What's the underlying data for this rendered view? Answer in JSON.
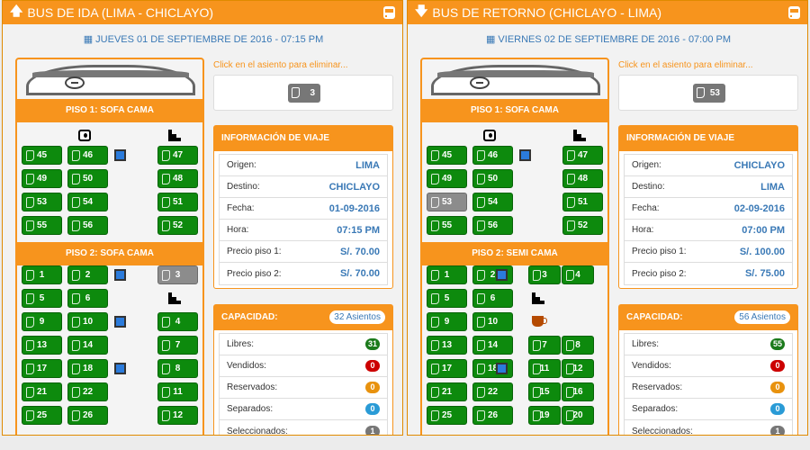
{
  "hint": "Click en el asiento para eliminar...",
  "info_title": "INFORMACIÓN DE VIAJE",
  "cap_title": "CAPACIDAD:",
  "labels": {
    "origen": "Origen:",
    "destino": "Destino:",
    "fecha": "Fecha:",
    "hora": "Hora:",
    "p1": "Precio piso 1:",
    "p2": "Precio piso 2:",
    "libres": "Libres:",
    "vendidos": "Vendidos:",
    "reservados": "Reservados:",
    "separados": "Separados:",
    "seleccionados": "Seleccionados:"
  },
  "colors": {
    "libres": "#1b7a1b",
    "vendidos": "#cc0000",
    "reservados": "#e8920e",
    "separados": "#2a9bd6",
    "seleccionados": "#777777"
  },
  "panels": [
    {
      "title": "BUS DE IDA (LIMA - CHICLAYO)",
      "arrow": "🡅",
      "date": "JUEVES 01 DE SEPTIEMBRE DE 2016 - 07:15 PM",
      "selected": "3",
      "floor1": "PISO 1: SOFA CAMA",
      "floor2": "PISO 2: SOFA CAMA",
      "info": {
        "origen": "LIMA",
        "destino": "CHICLAYO",
        "fecha": "01-09-2016",
        "hora": "07:15 PM",
        "p1": "S/. 70.00",
        "p2": "S/. 70.00"
      },
      "asientos": "32 Asientos",
      "cap": {
        "libres": "31",
        "vendidos": "0",
        "reservados": "0",
        "separados": "0",
        "seleccionados": "1"
      },
      "seats": [
        {
          "n": "45",
          "c": 0,
          "r": 1
        },
        {
          "n": "46",
          "c": 1,
          "r": 1
        },
        {
          "n": "47",
          "c": 3,
          "r": 1
        },
        {
          "n": "49",
          "c": 0,
          "r": 2
        },
        {
          "n": "50",
          "c": 1,
          "r": 2
        },
        {
          "n": "48",
          "c": 3,
          "r": 2
        },
        {
          "n": "53",
          "c": 0,
          "r": 3
        },
        {
          "n": "54",
          "c": 1,
          "r": 3
        },
        {
          "n": "51",
          "c": 3,
          "r": 3
        },
        {
          "n": "55",
          "c": 0,
          "r": 4
        },
        {
          "n": "56",
          "c": 1,
          "r": 4
        },
        {
          "n": "52",
          "c": 3,
          "r": 4
        },
        {
          "n": "1",
          "c": 0,
          "r": 6
        },
        {
          "n": "2",
          "c": 1,
          "r": 6
        },
        {
          "n": "3",
          "c": 3,
          "r": 6,
          "sel": true
        },
        {
          "n": "5",
          "c": 0,
          "r": 7
        },
        {
          "n": "6",
          "c": 1,
          "r": 7
        },
        {
          "n": "9",
          "c": 0,
          "r": 8
        },
        {
          "n": "10",
          "c": 1,
          "r": 8
        },
        {
          "n": "4",
          "c": 3,
          "r": 8
        },
        {
          "n": "13",
          "c": 0,
          "r": 9
        },
        {
          "n": "14",
          "c": 1,
          "r": 9
        },
        {
          "n": "7",
          "c": 3,
          "r": 9
        },
        {
          "n": "17",
          "c": 0,
          "r": 10
        },
        {
          "n": "18",
          "c": 1,
          "r": 10
        },
        {
          "n": "8",
          "c": 3,
          "r": 10
        },
        {
          "n": "21",
          "c": 0,
          "r": 11
        },
        {
          "n": "22",
          "c": 1,
          "r": 11
        },
        {
          "n": "11",
          "c": 3,
          "r": 11
        },
        {
          "n": "25",
          "c": 0,
          "r": 12
        },
        {
          "n": "26",
          "c": 1,
          "r": 12
        },
        {
          "n": "12",
          "c": 3,
          "r": 12
        }
      ],
      "icons": [
        {
          "t": "bath",
          "c": 1,
          "r": 0
        },
        {
          "t": "stairs",
          "c": 3,
          "r": 0
        },
        {
          "t": "tv",
          "c": 2,
          "r": 1
        },
        {
          "t": "tv",
          "c": 2,
          "r": 6
        },
        {
          "t": "stairs",
          "c": 3,
          "r": 7
        },
        {
          "t": "tv",
          "c": 2,
          "r": 8
        },
        {
          "t": "tv",
          "c": 2,
          "r": 10
        }
      ]
    },
    {
      "title": "BUS DE RETORNO (CHICLAYO - LIMA)",
      "arrow": "🡇",
      "date": "VIERNES 02 DE SEPTIEMBRE DE 2016 - 07:00 PM",
      "selected": "53",
      "floor1": "PISO 1: SOFA CAMA",
      "floor2": "PISO 2: SEMI CAMA",
      "info": {
        "origen": "CHICLAYO",
        "destino": "LIMA",
        "fecha": "02-09-2016",
        "hora": "07:00 PM",
        "p1": "S/. 100.00",
        "p2": "S/. 75.00"
      },
      "asientos": "56 Asientos",
      "cap": {
        "libres": "55",
        "vendidos": "0",
        "reservados": "0",
        "separados": "0",
        "seleccionados": "1"
      },
      "seats": [
        {
          "n": "45",
          "c": 0,
          "r": 1
        },
        {
          "n": "46",
          "c": 1,
          "r": 1
        },
        {
          "n": "47",
          "c": 3,
          "r": 1
        },
        {
          "n": "49",
          "c": 0,
          "r": 2
        },
        {
          "n": "50",
          "c": 1,
          "r": 2
        },
        {
          "n": "48",
          "c": 3,
          "r": 2
        },
        {
          "n": "53",
          "c": 0,
          "r": 3,
          "sel": true
        },
        {
          "n": "54",
          "c": 1,
          "r": 3
        },
        {
          "n": "51",
          "c": 3,
          "r": 3
        },
        {
          "n": "55",
          "c": 0,
          "r": 4
        },
        {
          "n": "56",
          "c": 1,
          "r": 4
        },
        {
          "n": "52",
          "c": 3,
          "r": 4
        },
        {
          "n": "1",
          "c": 0,
          "r": 6
        },
        {
          "n": "2",
          "c": 1,
          "r": 6
        },
        {
          "n": "3",
          "c": 2.5,
          "r": 6
        },
        {
          "n": "4",
          "c": 3.3,
          "r": 6
        },
        {
          "n": "5",
          "c": 0,
          "r": 7
        },
        {
          "n": "6",
          "c": 1,
          "r": 7
        },
        {
          "n": "9",
          "c": 0,
          "r": 8
        },
        {
          "n": "10",
          "c": 1,
          "r": 8
        },
        {
          "n": "13",
          "c": 0,
          "r": 9
        },
        {
          "n": "14",
          "c": 1,
          "r": 9
        },
        {
          "n": "7",
          "c": 2.5,
          "r": 9
        },
        {
          "n": "8",
          "c": 3.3,
          "r": 9
        },
        {
          "n": "17",
          "c": 0,
          "r": 10
        },
        {
          "n": "18",
          "c": 1,
          "r": 10
        },
        {
          "n": "11",
          "c": 2.5,
          "r": 10
        },
        {
          "n": "12",
          "c": 3.3,
          "r": 10
        },
        {
          "n": "21",
          "c": 0,
          "r": 11
        },
        {
          "n": "22",
          "c": 1,
          "r": 11
        },
        {
          "n": "15",
          "c": 2.5,
          "r": 11
        },
        {
          "n": "16",
          "c": 3.3,
          "r": 11
        },
        {
          "n": "25",
          "c": 0,
          "r": 12
        },
        {
          "n": "26",
          "c": 1,
          "r": 12
        },
        {
          "n": "19",
          "c": 2.5,
          "r": 12
        },
        {
          "n": "20",
          "c": 3.3,
          "r": 12
        }
      ],
      "icons": [
        {
          "t": "bath",
          "c": 1,
          "r": 0
        },
        {
          "t": "stairs",
          "c": 3,
          "r": 0
        },
        {
          "t": "tv",
          "c": 2,
          "r": 1
        },
        {
          "t": "tv",
          "c": 1.8,
          "r": 6
        },
        {
          "t": "stairs",
          "c": 2.6,
          "r": 7
        },
        {
          "t": "cup",
          "c": 2.6,
          "r": 8
        },
        {
          "t": "tv",
          "c": 1.8,
          "r": 10
        }
      ]
    }
  ]
}
